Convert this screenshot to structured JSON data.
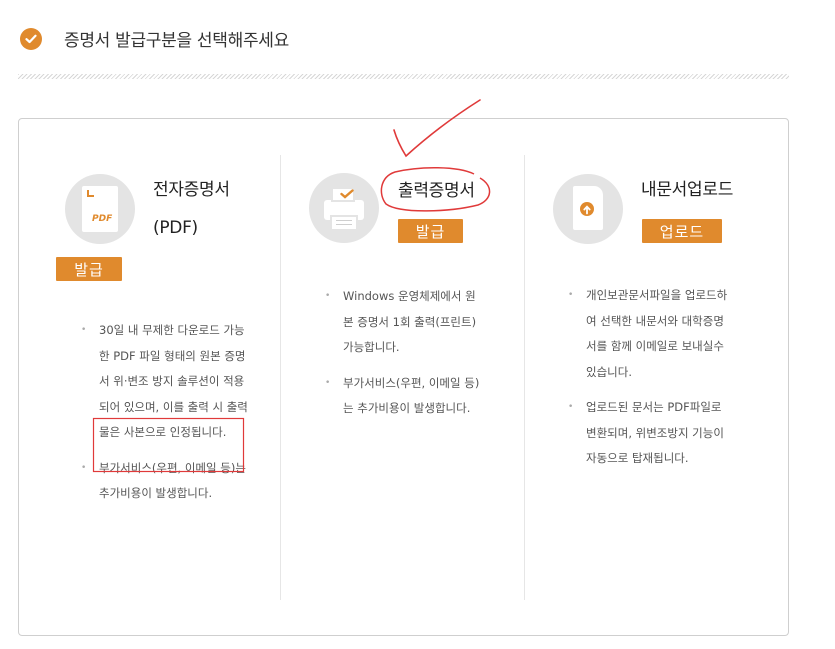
{
  "header": {
    "title": "증명서 발급구분을 선택해주세요",
    "accent_color": "#e08a2d"
  },
  "options": [
    {
      "icon": "pdf-document-icon",
      "icon_label": "PDF",
      "title": "전자증명서",
      "subtitle": "(PDF)",
      "button": "발급",
      "bullets": [
        "30일 내 무제한 다운로드 가능한 PDF 파일 형태의 원본 증명서 위·변조 방지 솔루션이 적용되어 있으며, 이를 출력 시 출력물은 사본으로 인정됩니다.",
        "부가서비스(우편, 이메일 등)는 추가비용이 발생합니다."
      ]
    },
    {
      "icon": "printer-icon",
      "title": "출력증명서",
      "button": "발급",
      "bullets": [
        "Windows 운영체제에서 원본 증명서 1회 출력(프린트) 가능합니다.",
        "부가서비스(우편, 이메일 등)는 추가비용이 발생합니다."
      ]
    },
    {
      "icon": "upload-document-icon",
      "title": "내문서업로드",
      "button": "업로드",
      "bullets": [
        "개인보관문서파일을 업로드하여 선택한 내문서와 대학증명서를 함께 이메일로 보내실수 있습니다.",
        "업로드된 문서는 PDF파일로 변환되며, 위변조방지 기능이 자동으로 탑재됩니다."
      ]
    }
  ],
  "annotation_color": "#e03a3a"
}
